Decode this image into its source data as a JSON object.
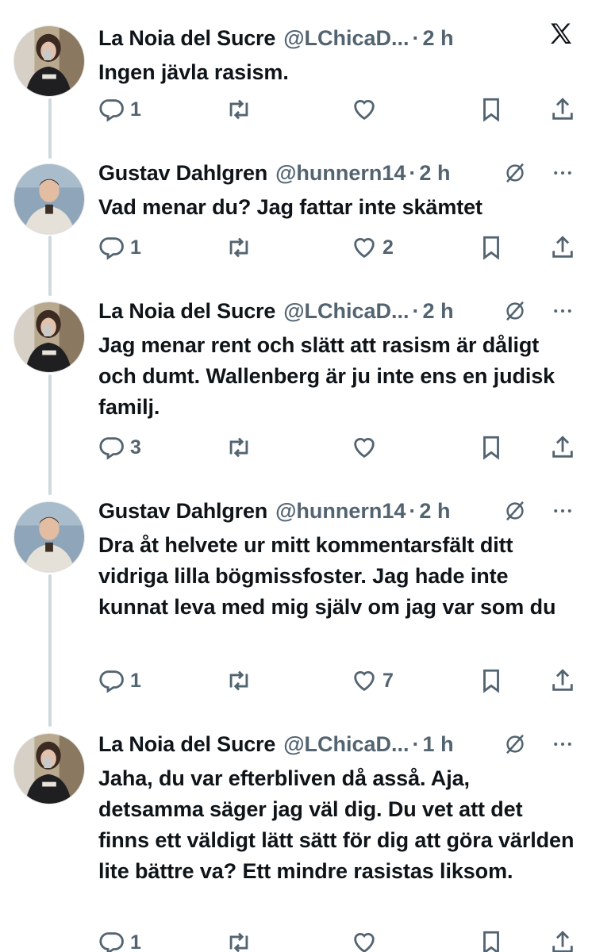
{
  "tweets": [
    {
      "name": "La Noia del Sucre",
      "handle": "@LChicaD...",
      "time": "2 h",
      "text": "Ingen jävla rasism.",
      "replies": "1",
      "retweets": "",
      "likes": "",
      "header_icon": "x-logo-icon"
    },
    {
      "name": "Gustav Dahlgren",
      "handle": "@hunnern14",
      "time": "2 h",
      "text": "Vad menar du? Jag fattar inte skämtet",
      "replies": "1",
      "retweets": "",
      "likes": "2",
      "header_icon": "muted-icon"
    },
    {
      "name": "La Noia del Sucre",
      "handle": "@LChicaD...",
      "time": "2 h",
      "text": "Jag menar rent och slätt att rasism är dåligt och dumt. Wallenberg är ju inte ens en judisk familj.",
      "replies": "3",
      "retweets": "",
      "likes": "",
      "header_icon": "muted-icon"
    },
    {
      "name": "Gustav Dahlgren",
      "handle": "@hunnern14",
      "time": "2 h",
      "text": "Dra åt helvete ur mitt kommentarsfält ditt vidriga lilla bögmissfoster. Jag hade inte kunnat leva med mig själv om jag var som du",
      "replies": "1",
      "retweets": "",
      "likes": "7",
      "header_icon": "muted-icon"
    },
    {
      "name": "La Noia del Sucre",
      "handle": "@LChicaD...",
      "time": "1 h",
      "text": "Jaha, du var efterbliven då asså. Aja, detsamma säger jag väl dig. Du vet att det finns ett väldigt lätt sätt för dig att göra världen lite bättre va? Ett mindre rasistas liksom.",
      "replies": "1",
      "retweets": "",
      "likes": "",
      "header_icon": "muted-icon"
    }
  ],
  "colors": {
    "text": "#0f1419",
    "secondary": "#536471",
    "thread_line": "#cfd9de"
  }
}
